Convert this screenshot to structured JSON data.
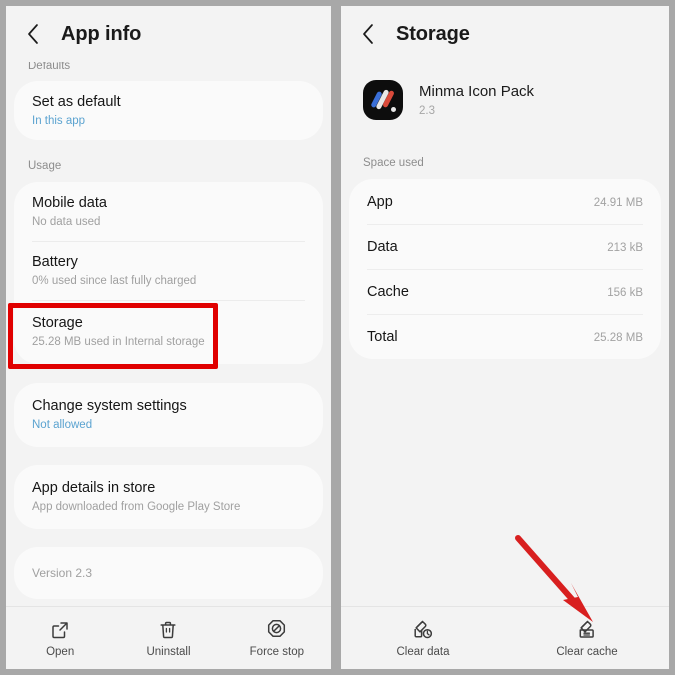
{
  "left_panel": {
    "header": {
      "title": "App info",
      "back_icon": "chevron-left-icon"
    },
    "sections": [
      {
        "label": "Defaults"
      },
      {
        "label": "Usage"
      }
    ],
    "defaults_rows": [
      {
        "title": "Set as default",
        "subtitle": "In this app",
        "subtitle_is_link": true
      }
    ],
    "usage_rows": [
      {
        "title": "Mobile data",
        "subtitle": "No data used"
      },
      {
        "title": "Battery",
        "subtitle": "0% used since last fully charged"
      },
      {
        "title": "Storage",
        "subtitle": "25.28 MB used in Internal storage"
      }
    ],
    "permissions_rows": [
      {
        "title": "Change system settings",
        "subtitle": "Not allowed",
        "subtitle_is_link": true
      }
    ],
    "store_rows": [
      {
        "title": "App details in store",
        "subtitle": "App downloaded from Google Play Store"
      }
    ],
    "version_text": "Version 2.3",
    "toolbar": [
      {
        "label": "Open",
        "icon": "open-in-new-icon"
      },
      {
        "label": "Uninstall",
        "icon": "trash-icon"
      },
      {
        "label": "Force stop",
        "icon": "block-octagon-icon"
      }
    ]
  },
  "right_panel": {
    "header": {
      "title": "Storage",
      "back_icon": "chevron-left-icon"
    },
    "app": {
      "name": "Minma Icon Pack",
      "version": "2.3",
      "icon": "minma-icon-pack-app-icon"
    },
    "section_label": "Space used",
    "storage_rows": [
      {
        "key": "App",
        "value": "24.91 MB"
      },
      {
        "key": "Data",
        "value": "213 kB"
      },
      {
        "key": "Cache",
        "value": "156 kB"
      },
      {
        "key": "Total",
        "value": "25.28 MB"
      }
    ],
    "toolbar": [
      {
        "label": "Clear data",
        "icon": "clear-data-brush-icon"
      },
      {
        "label": "Clear cache",
        "icon": "clear-cache-brush-icon"
      }
    ]
  },
  "annotations": {
    "highlight_color": "#e00000",
    "arrow_color": "#d81f1f",
    "highlight_target": "Storage",
    "arrow_target": "Clear cache"
  }
}
